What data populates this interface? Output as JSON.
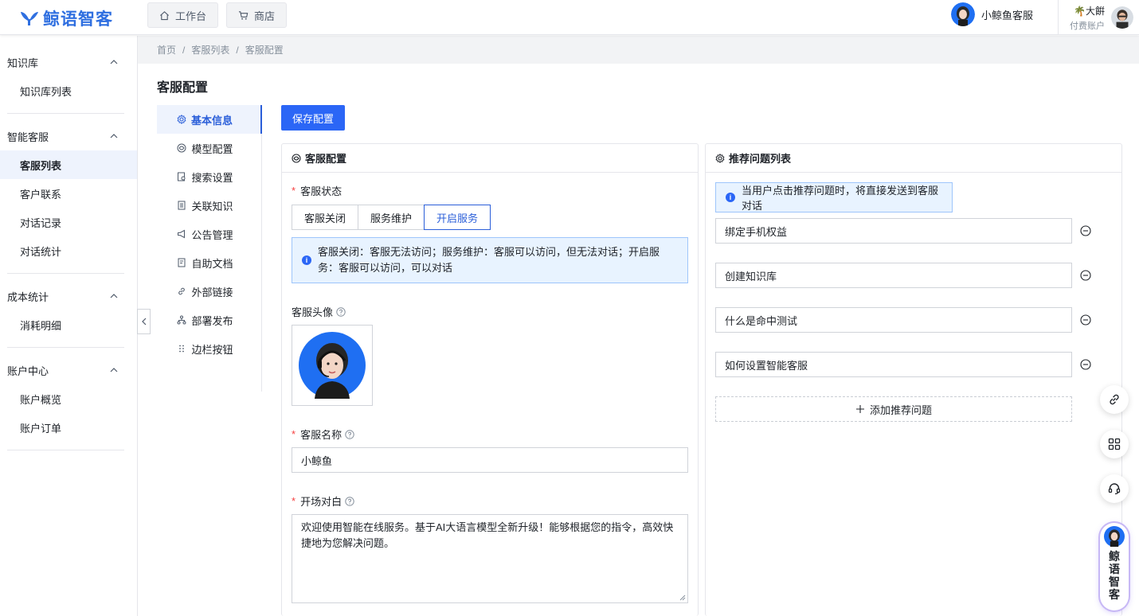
{
  "app": {
    "logo_text": "鲸语智客"
  },
  "topnav": [
    {
      "label": "工作台",
      "icon": "home-icon"
    },
    {
      "label": "商店",
      "icon": "cart-icon"
    }
  ],
  "agent": {
    "name": "小鲸鱼客服"
  },
  "user": {
    "name": "大餠",
    "type": "付费账户"
  },
  "sidebar": {
    "groups": [
      {
        "title": "知识库",
        "items": [
          {
            "label": "知识库列表"
          }
        ]
      },
      {
        "title": "智能客服",
        "items": [
          {
            "label": "客服列表",
            "active": true
          },
          {
            "label": "客户联系"
          },
          {
            "label": "对话记录"
          },
          {
            "label": "对话统计"
          }
        ]
      },
      {
        "title": "成本统计",
        "items": [
          {
            "label": "消耗明细"
          }
        ]
      },
      {
        "title": "账户中心",
        "items": [
          {
            "label": "账户概览"
          },
          {
            "label": "账户订单"
          }
        ]
      }
    ]
  },
  "breadcrumb": [
    "首页",
    "/",
    "客服列表",
    "/",
    "客服配置"
  ],
  "page": {
    "title": "客服配置",
    "save_label": "保存配置"
  },
  "config_nav": [
    {
      "label": "基本信息",
      "icon": "gear-icon",
      "active": true
    },
    {
      "label": "模型配置",
      "icon": "model-icon"
    },
    {
      "label": "搜索设置",
      "icon": "search-doc-icon"
    },
    {
      "label": "关联知识",
      "icon": "book-icon"
    },
    {
      "label": "公告管理",
      "icon": "megaphone-icon"
    },
    {
      "label": "自助文档",
      "icon": "doc-icon"
    },
    {
      "label": "外部链接",
      "icon": "link-icon"
    },
    {
      "label": "部署发布",
      "icon": "deploy-icon"
    },
    {
      "label": "边栏按钮",
      "icon": "grip-icon"
    }
  ],
  "left_panel": {
    "title": "客服配置",
    "status_label": "客服状态",
    "status_options": [
      "客服关闭",
      "服务维护",
      "开启服务"
    ],
    "status_selected": "开启服务",
    "status_info": "客服关闭：客服无法访问；服务维护：客服可以访问，但无法对话；开启服务：客服可以访问，可以对话",
    "avatar_label": "客服头像",
    "name_label": "客服名称",
    "name_value": "小鲸鱼",
    "opening_label": "开场对白",
    "opening_value": "欢迎使用智能在线服务。基于AI大语言模型全新升级！能够根据您的指令，高效快捷地为您解决问题。"
  },
  "right_panel": {
    "title": "推荐问题列表",
    "info": "当用户点击推荐问题时，将直接发送到客服对话",
    "questions": [
      "绑定手机权益",
      "创建知识库",
      "什么是命中测试",
      "如何设置智能客服"
    ],
    "add_label": "添加推荐问题"
  },
  "floating": {
    "brand": "鲸语智客",
    "buttons": [
      "link-icon",
      "apps-icon",
      "headset-icon"
    ]
  },
  "colors": {
    "primary": "#2b66f6",
    "active_bg": "#eef3fd",
    "info_bg": "#e8f3ff"
  }
}
